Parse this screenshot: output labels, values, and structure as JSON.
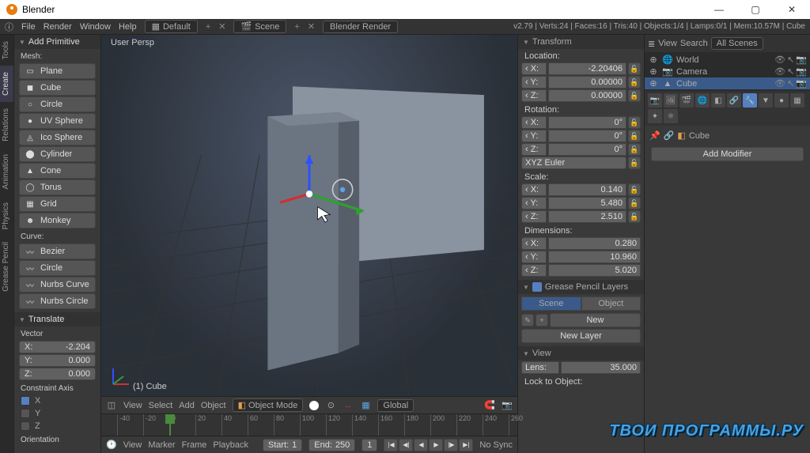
{
  "window": {
    "title": "Blender",
    "min": "—",
    "max": "▢",
    "close": "✕"
  },
  "menubar": {
    "items": [
      "File",
      "Render",
      "Window",
      "Help"
    ],
    "layout": "Default",
    "scene": "Scene",
    "engine": "Blender Render"
  },
  "stats": "v2.79 | Verts:24 | Faces:16 | Tris:40 | Objects:1/4 | Lamps:0/1 | Mem:10.57M | Cube",
  "vtabs": [
    "Tools",
    "Create",
    "Relations",
    "Animation",
    "Physics",
    "Grease Pencil"
  ],
  "addprim": {
    "header": "Add Primitive",
    "mesh_label": "Mesh:",
    "mesh": [
      "Plane",
      "Cube",
      "Circle",
      "UV Sphere",
      "Ico Sphere",
      "Cylinder",
      "Cone",
      "Torus",
      "Grid",
      "Monkey"
    ],
    "mesh_icons": [
      "▭",
      "◼",
      "○",
      "●",
      "◬",
      "⬤",
      "▲",
      "◯",
      "▦",
      "☻"
    ],
    "curve_label": "Curve:",
    "curve": [
      "Bezier",
      "Circle",
      "Nurbs Curve",
      "Nurbs Circle"
    ]
  },
  "translate": {
    "header": "Translate",
    "vector_label": "Vector",
    "x": "-2.204",
    "y": "0.000",
    "z": "0.000",
    "constraint_label": "Constraint Axis",
    "cx": true,
    "cy": false,
    "cz": false,
    "orientation": "Orientation"
  },
  "viewport": {
    "persp": "User Persp",
    "objlabel": "(1) Cube"
  },
  "vheader": {
    "view": "View",
    "select": "Select",
    "add": "Add",
    "object": "Object",
    "mode": "Object Mode",
    "orient": "Global"
  },
  "timeline": {
    "ticks": [
      "-40",
      "-20",
      "0",
      "20",
      "40",
      "60",
      "80",
      "100",
      "120",
      "140",
      "160",
      "180",
      "200",
      "220",
      "240",
      "260"
    ],
    "view": "View",
    "marker": "Marker",
    "frame": "Frame",
    "playback": "Playback",
    "start": "Start:",
    "start_v": "1",
    "end": "End:",
    "end_v": "250",
    "cur": "1",
    "sync": "No Sync"
  },
  "npanel": {
    "transform": "Transform",
    "loc_label": "Location:",
    "loc": {
      "x": "-2.20406",
      "y": "0.00000",
      "z": "0.00000"
    },
    "rot_label": "Rotation:",
    "rot": {
      "x": "0°",
      "y": "0°",
      "z": "0°"
    },
    "rot_mode": "XYZ Euler",
    "scale_label": "Scale:",
    "scale": {
      "x": "0.140",
      "y": "5.480",
      "z": "2.510"
    },
    "dim_label": "Dimensions:",
    "dim": {
      "x": "0.280",
      "y": "10.960",
      "z": "5.020"
    },
    "gp_header": "Grease Pencil Layers",
    "gp_scene": "Scene",
    "gp_object": "Object",
    "gp_new": "New",
    "gp_newlayer": "New Layer",
    "view_header": "View",
    "lens": "Lens:",
    "lens_v": "35.000",
    "lock": "Lock to Object:"
  },
  "outliner": {
    "view": "View",
    "search": "Search",
    "filter": "All Scenes",
    "items": [
      {
        "icon": "🌐",
        "name": "World",
        "sel": false
      },
      {
        "icon": "📷",
        "name": "Camera",
        "sel": false
      },
      {
        "icon": "▲",
        "name": "Cube",
        "sel": true
      }
    ]
  },
  "props": {
    "pin": "📌",
    "obj_icon": "◧",
    "obj_name": "Cube",
    "add_mod": "Add Modifier"
  },
  "watermark": "ТВОИ ПРОГРАММЫ.РУ"
}
